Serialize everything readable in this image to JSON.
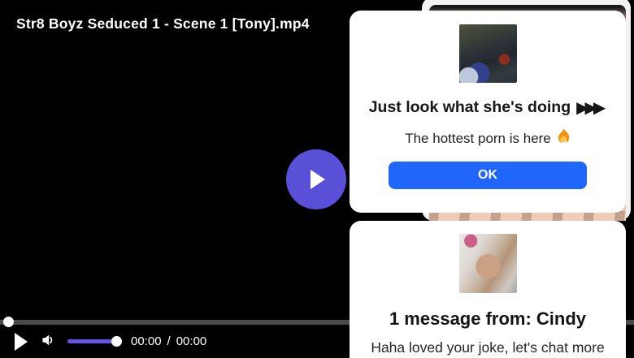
{
  "page": {
    "background_color": "#000000"
  },
  "player": {
    "title": "Str8 Boyz Seduced 1 - Scene 1 [Tony].mp4",
    "big_play": {
      "icon": "play-icon",
      "color": "#5a50d8"
    },
    "progress": {
      "percent": 0,
      "track_color": "#4a4a4a"
    },
    "controls": {
      "play_icon": "play-icon",
      "volume_icon": "speaker-icon",
      "volume_percent": 100,
      "volume_color": "#6156e8",
      "current_time": "00:00",
      "separator": "/",
      "duration": "00:00"
    }
  },
  "offer_popup": {
    "thumbnail": "webcam-photo-thumbnail",
    "heading": "Just look what she's doing",
    "heading_arrows": "▶▶▶",
    "subtext": "The hottest porn is here",
    "subtext_icon": "fire-icon",
    "ok_label": "OK",
    "ok_color": "#2166fa"
  },
  "message_popup": {
    "thumbnail": "sender-photo-thumbnail",
    "heading": "1 message from: Cindy",
    "message": "Haha loved your joke, let's chat more"
  }
}
